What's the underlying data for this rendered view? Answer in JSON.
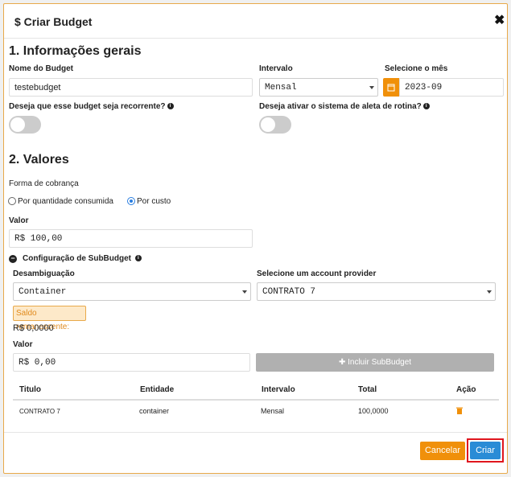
{
  "dialog": {
    "title": "$ Criar Budget"
  },
  "section1": {
    "heading": "1. Informações gerais",
    "name_label": "Nome do Budget",
    "name_value": "testebudget",
    "interval_label": "Intervalo",
    "interval_value": "Mensal",
    "month_label": "Selecione o mês",
    "month_value": "2023-09",
    "recurrent_label": "Deseja que esse budget seja recorrente?",
    "alert_label": "Deseja ativar o sistema de aleta de rotina?"
  },
  "section2": {
    "heading": "2. Valores",
    "billing_label": "Forma de cobrança",
    "radio_qty": "Por quantidade consumida",
    "radio_cost": "Por custo",
    "valor_label": "Valor",
    "valor_value": "R$ 100,00",
    "subbudget_label": "Configuração de SubBudget",
    "disambig_label": "Desambiguação",
    "disambig_value": "Container",
    "provider_label": "Selecione um account provider",
    "provider_value": "CONTRATO 7",
    "saldo_label": "Saldo remanescente:",
    "saldo_value": "R$ 0,0000",
    "sub_valor_label": "Valor",
    "sub_valor_value": "R$ 0,00",
    "include_button": "Incluir SubBudget"
  },
  "table": {
    "headers": [
      "Titulo",
      "Entidade",
      "Intervalo",
      "Total",
      "Ação"
    ],
    "rows": [
      {
        "titulo": "CONTRATO 7",
        "entidade": "container",
        "intervalo": "Mensal",
        "total": "100,0000"
      }
    ]
  },
  "footer": {
    "cancel": "Cancelar",
    "create": "Criar"
  },
  "colors": {
    "accent_orange": "#f0900a",
    "primary_blue": "#2a8cd6",
    "highlight_red": "#e0161e"
  }
}
